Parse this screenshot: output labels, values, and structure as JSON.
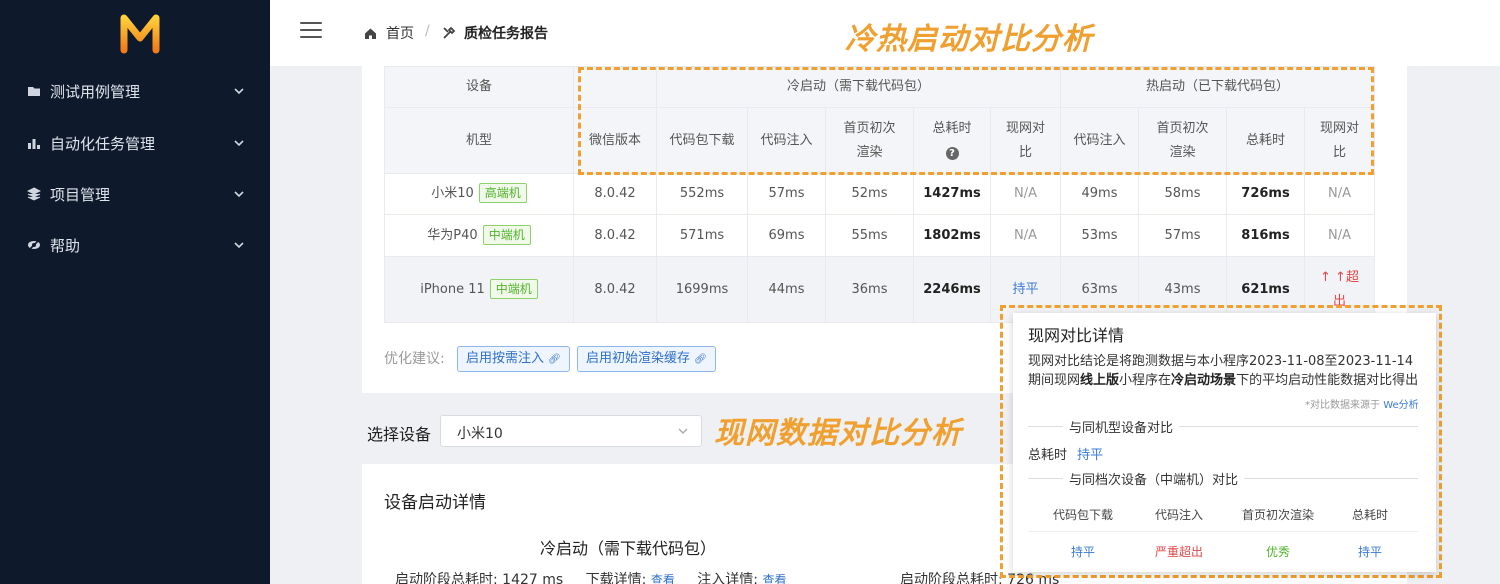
{
  "sidebar": {
    "logo": "M",
    "items": [
      {
        "label": "测试用例管理",
        "icon": "folder-icon"
      },
      {
        "label": "自动化任务管理",
        "icon": "bar-chart-icon"
      },
      {
        "label": "项目管理",
        "icon": "layers-icon"
      },
      {
        "label": "帮助",
        "icon": "eye-off-icon"
      }
    ]
  },
  "header": {
    "breadcrumb_home": "首页",
    "breadcrumb_sep": "/",
    "breadcrumb_current": "质检任务报告"
  },
  "annotations": {
    "title_1": "冷热启动对比分析",
    "title_2": "现网数据对比分析"
  },
  "table": {
    "group_device": "设备",
    "group_cold": "冷启动（需下载代码包）",
    "group_hot": "热启动（已下载代码包）",
    "columns": {
      "model": "机型",
      "wechat": "微信版本",
      "pkg_download": "代码包下载",
      "inject": "代码注入",
      "first_render_1": "首页初次",
      "first_render_2": "渲染",
      "total": "总耗时",
      "compare_1": "现网对",
      "compare_2": "比",
      "hot_inject": "代码注入",
      "hot_render_1": "首页初次",
      "hot_render_2": "渲染",
      "hot_total": "总耗时",
      "hot_compare_1": "现网对",
      "hot_compare_2": "比"
    },
    "rows": [
      {
        "model": "小米10",
        "tag": "高端机",
        "wechat": "8.0.42",
        "download": "552ms",
        "inject": "57ms",
        "render": "52ms",
        "total": "1427ms",
        "compare": "N/A",
        "hot_inject": "49ms",
        "hot_render": "58ms",
        "hot_total": "726ms",
        "hot_compare": "N/A"
      },
      {
        "model": "华为P40",
        "tag": "中端机",
        "wechat": "8.0.42",
        "download": "571ms",
        "inject": "69ms",
        "render": "55ms",
        "total": "1802ms",
        "compare": "N/A",
        "hot_inject": "53ms",
        "hot_render": "57ms",
        "hot_total": "816ms",
        "hot_compare": "N/A"
      },
      {
        "model": "iPhone 11",
        "tag": "中端机",
        "wechat": "8.0.42",
        "download": "1699ms",
        "inject": "44ms",
        "render": "36ms",
        "total": "2246ms",
        "compare": "持平",
        "hot_inject": "63ms",
        "hot_render": "43ms",
        "hot_total": "621ms",
        "hot_compare_1": "↑ ↑超",
        "hot_compare_2": "出"
      }
    ]
  },
  "optimize": {
    "label": "优化建议:",
    "btn_1": "启用按需注入",
    "btn_2": "启用初始渲染缓存"
  },
  "device_select": {
    "label": "选择设备",
    "value": "小米10"
  },
  "details": {
    "title": "设备启动详情",
    "cold_title": "冷启动（需下载代码包）",
    "stage_label": "启动阶段总耗时:",
    "stage_value": "1427 ms",
    "download_label": "下载详情:",
    "inject_label": "注入详情:",
    "view_link": "查看",
    "stage_label_2": "启动阶段总耗时:",
    "stage_value_2": "726 ms"
  },
  "popover": {
    "title": "现网对比详情",
    "desc_1": "现网对比结论是将跑测数据与本小程序2023-11-08至2023-11-14期间现网",
    "desc_bold_1": "线上版",
    "desc_2": "小程序在",
    "desc_bold_2": "冷启动场景",
    "desc_3": "下的平均启动性能数据对比得出",
    "source_prefix": "*对比数据来源于",
    "source_link": "We分析",
    "sec_1": "与同机型设备对比",
    "kv_label": "总耗时",
    "kv_value": "持平",
    "sec_2": "与同档次设备（中端机）对比",
    "cols": [
      "代码包下载",
      "代码注入",
      "首页初次渲染",
      "总耗时"
    ],
    "vals": [
      "持平",
      "严重超出",
      "优秀",
      "持平"
    ]
  },
  "colors": {
    "sidebar_bg": "#0e1a2c",
    "accent_orange": "#f0a030",
    "link_blue": "#3a7bd5",
    "danger_red": "#e04848",
    "success_green": "#52b32b"
  }
}
